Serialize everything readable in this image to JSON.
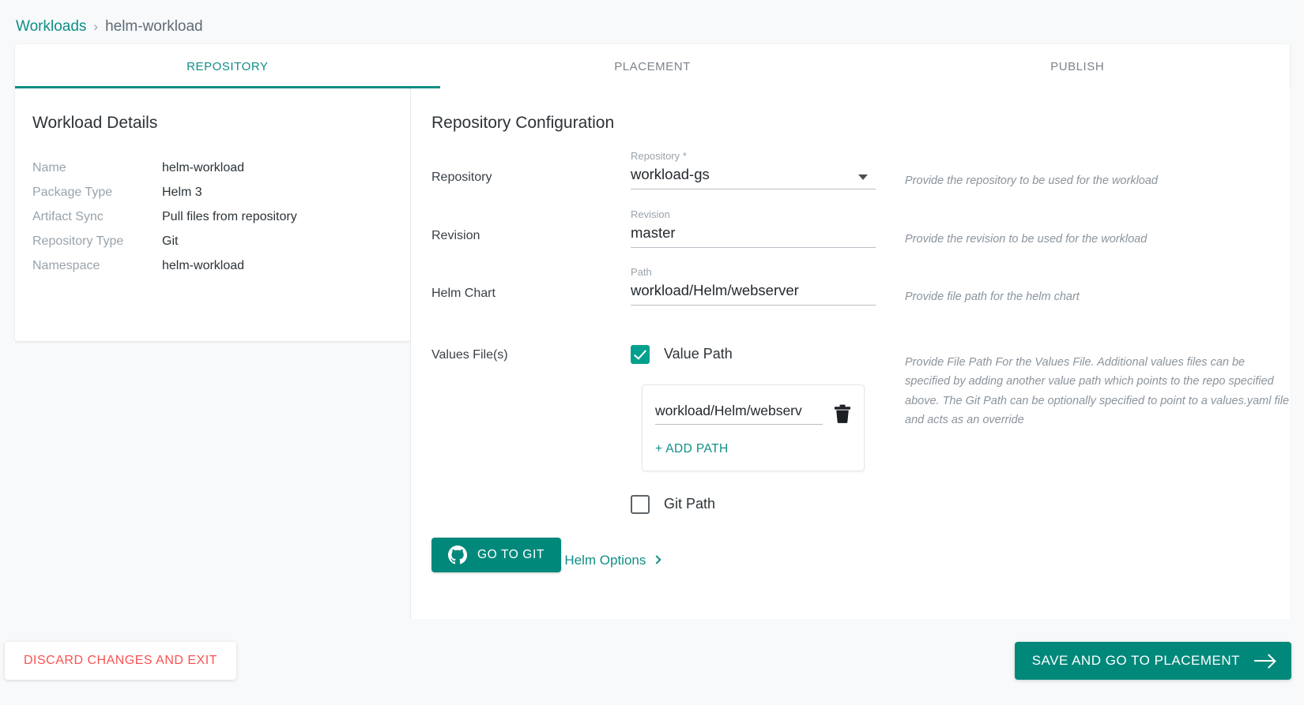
{
  "breadcrumb": {
    "root": "Workloads",
    "separator": "›",
    "current": "helm-workload"
  },
  "tabs": [
    {
      "label": "REPOSITORY",
      "active": true
    },
    {
      "label": "PLACEMENT",
      "active": false
    },
    {
      "label": "PUBLISH",
      "active": false
    }
  ],
  "workload_details": {
    "title": "Workload Details",
    "rows": [
      {
        "key": "Name",
        "value": "helm-workload"
      },
      {
        "key": "Package Type",
        "value": "Helm 3"
      },
      {
        "key": "Artifact Sync",
        "value": "Pull files from repository"
      },
      {
        "key": "Repository Type",
        "value": "Git"
      },
      {
        "key": "Namespace",
        "value": "helm-workload"
      }
    ]
  },
  "repository_config": {
    "title": "Repository Configuration",
    "repository": {
      "row_label": "Repository",
      "field_label": "Repository *",
      "value": "workload-gs",
      "hint": "Provide the repository to be used for the workload"
    },
    "revision": {
      "row_label": "Revision",
      "field_label": "Revision",
      "value": "master",
      "hint": "Provide the revision to be used for the workload"
    },
    "helm_chart": {
      "row_label": "Helm Chart",
      "field_label": "Path",
      "value": "workload/Helm/webserver",
      "hint": "Provide file path for the helm chart"
    },
    "values_files": {
      "row_label": "Values File(s)",
      "hint": "Provide File Path For the Values File. Additional values files can be specified by adding another value path which points to the repo specified above. The Git Path can be optionally specified to point to a values.yaml file and acts as an override",
      "value_path": {
        "label": "Value Path",
        "checked": true,
        "paths": [
          "workload/Helm/webserv"
        ],
        "add_path_label": "+ ADD  PATH"
      },
      "git_path": {
        "label": "Git Path",
        "checked": false
      }
    },
    "go_to_git_label": "GO TO GIT",
    "helm_options_label": "Helm Options"
  },
  "footer": {
    "discard_label": "DISCARD CHANGES AND EXIT",
    "save_label": "SAVE AND GO TO PLACEMENT"
  },
  "colors": {
    "accent": "#00897b",
    "accent_link": "#0f8f85",
    "checkbox_checked": "#00a08e",
    "danger": "#fa5252",
    "page_bg": "#f7f9fa"
  }
}
